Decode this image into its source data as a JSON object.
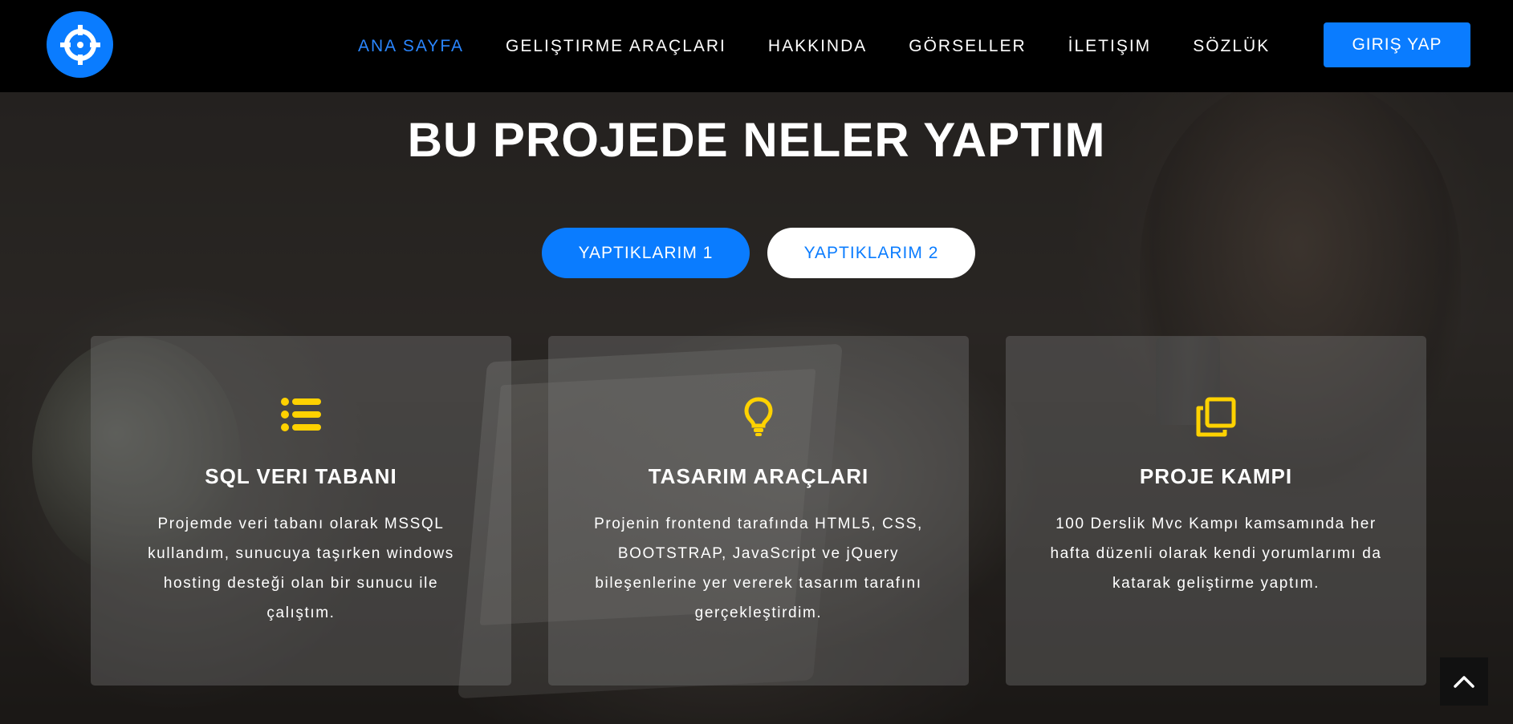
{
  "nav": {
    "items": [
      {
        "label": "ANA SAYFA",
        "active": true
      },
      {
        "label": "GELIŞTIRME ARAÇLARI",
        "active": false
      },
      {
        "label": "HAKKINDA",
        "active": false
      },
      {
        "label": "GÖRSELLER",
        "active": false
      },
      {
        "label": "İLETIŞIM",
        "active": false
      },
      {
        "label": "SÖZLÜK",
        "active": false
      }
    ],
    "login_label": "GIRIŞ YAP",
    "logo_icon": "crosshair-icon"
  },
  "hero": {
    "title": "BU PROJEDE NELER YAPTIM",
    "tabs": [
      {
        "label": "YAPTIKLARIM 1",
        "active": true
      },
      {
        "label": "YAPTIKLARIM 2",
        "active": false
      }
    ]
  },
  "cards": [
    {
      "icon": "list-icon",
      "title": "SQL VERI TABANI",
      "text": "Projemde veri tabanı olarak MSSQL kullandım, sunucuya taşırken windows hosting desteği olan bir sunucu ile çalıştım."
    },
    {
      "icon": "lightbulb-icon",
      "title": "TASARIM ARAÇLARI",
      "text": "Projenin frontend tarafında HTML5, CSS, BOOTSTRAP, JavaScript ve jQuery bileşenlerine yer vererek tasarım tarafını gerçekleştirdim."
    },
    {
      "icon": "copy-icon",
      "title": "PROJE KAMPI",
      "text": "100 Derslik Mvc Kampı kamsamında her hafta düzenli olarak kendi yorumlarımı da katarak geliştirme yaptım."
    }
  ],
  "colors": {
    "accent": "#0a7cff",
    "icon_yellow": "#ffd200",
    "nav_bg": "#000000"
  },
  "scroll_top_icon": "chevron-up-icon"
}
